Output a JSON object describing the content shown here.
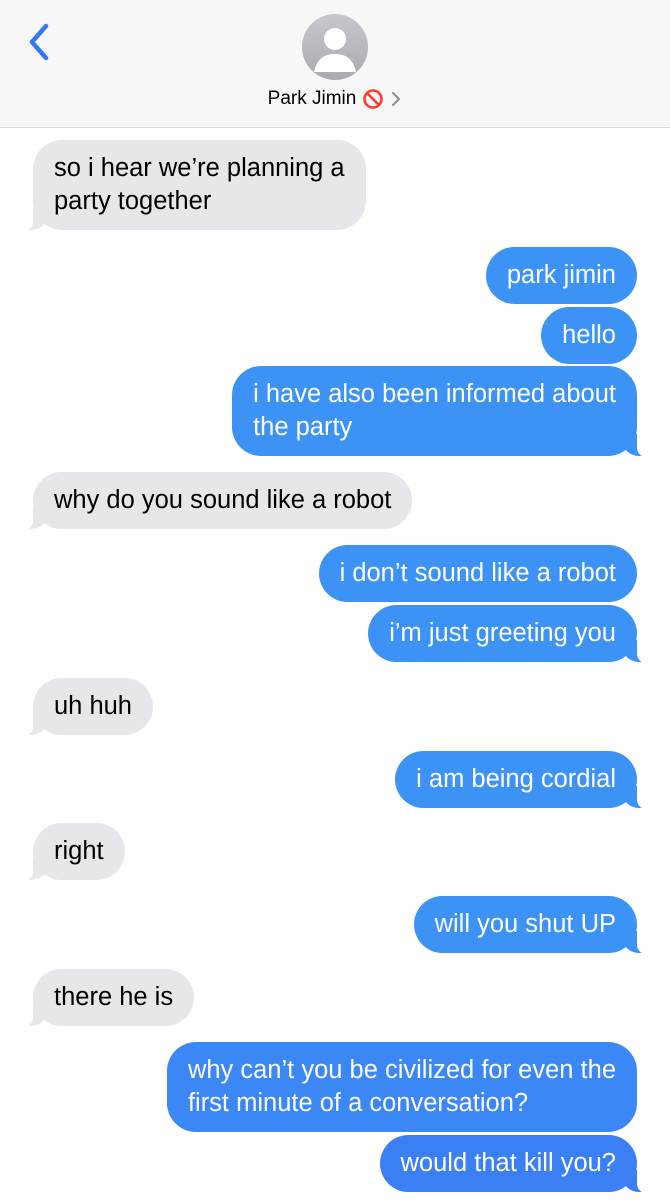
{
  "header": {
    "contact_name": "Park Jimin",
    "icons": {
      "back": "chevron-left-icon",
      "avatar": "person-silhouette-icon",
      "status": "no-entry-icon",
      "more": "chevron-right-icon"
    },
    "accent_color": "#3478f6",
    "status_color": "#ff3b30"
  },
  "colors": {
    "incoming_bubble": "#e6e6eb",
    "outgoing_bubble": "#3d93f5"
  },
  "messages": [
    {
      "direction": "incoming",
      "lines": [
        "so i hear we’re planning a",
        "party together"
      ]
    },
    {
      "direction": "outgoing",
      "lines": [
        "park jimin"
      ]
    },
    {
      "direction": "outgoing",
      "lines": [
        "hello"
      ]
    },
    {
      "direction": "outgoing",
      "lines": [
        "i have also been informed about",
        "the party"
      ]
    },
    {
      "direction": "incoming",
      "lines": [
        "why do you sound like a robot"
      ]
    },
    {
      "direction": "outgoing",
      "lines": [
        "i don’t sound like a robot"
      ]
    },
    {
      "direction": "outgoing",
      "lines": [
        "i’m just greeting you"
      ]
    },
    {
      "direction": "incoming",
      "lines": [
        "uh huh"
      ]
    },
    {
      "direction": "outgoing",
      "lines": [
        "i am being cordial"
      ]
    },
    {
      "direction": "incoming",
      "lines": [
        "right"
      ]
    },
    {
      "direction": "outgoing",
      "lines": [
        "will you shut UP"
      ]
    },
    {
      "direction": "incoming",
      "lines": [
        "there he is"
      ]
    },
    {
      "direction": "outgoing",
      "lines": [
        "why can’t you be civilized for even the",
        "first minute of a conversation?"
      ]
    },
    {
      "direction": "outgoing",
      "lines": [
        "would that kill you?"
      ]
    }
  ]
}
